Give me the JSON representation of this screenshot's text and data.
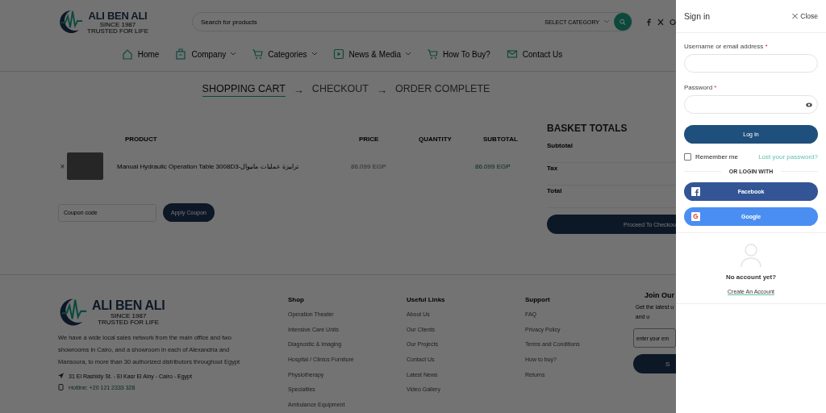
{
  "header": {
    "logo": {
      "name": "ALI BEN ALI",
      "since": "SINCE 1987",
      "tagline": "TRUSTED FOR LIFE"
    },
    "search": {
      "placeholder": "Search for products",
      "category": "SELECT CATEGORY"
    }
  },
  "nav": [
    {
      "label": "Home",
      "dropdown": false
    },
    {
      "label": "Company",
      "dropdown": true
    },
    {
      "label": "Categories",
      "dropdown": true
    },
    {
      "label": "News & Media",
      "dropdown": true
    },
    {
      "label": "How To Buy?",
      "dropdown": false
    },
    {
      "label": "Contact Us",
      "dropdown": false
    }
  ],
  "steps": [
    {
      "label": "SHOPPING CART",
      "selected": true
    },
    {
      "arrow": "→",
      "label": "CHECKOUT",
      "selected": false
    },
    {
      "arrow": "→",
      "label": "ORDER COMPLETE",
      "selected": false
    }
  ],
  "cart": {
    "columns": [
      "PRODUCT",
      "PRICE",
      "QUANTITY",
      "SUBTOTAL"
    ],
    "rows": [
      {
        "remove": "×",
        "product": "Manual Hydraulic Operation Table 3008D3-ترابيزة عمليات مانيوال",
        "price": "86.099 EGP",
        "subtotal": "86.099 EGP"
      }
    ],
    "coupon": {
      "placeholder": "Coupon code",
      "button": "Apply Coupon"
    }
  },
  "totals": {
    "title": "BASKET TOTALS",
    "rows": [
      "Subtotal",
      "Tax",
      "Total"
    ],
    "button": "Proceed To Checkou"
  },
  "footer": {
    "logo": {
      "name": "ALI BEN ALI",
      "since": "SINCE 1987",
      "tagline": "TRUSTED FOR LIFE"
    },
    "about": "We have a wide local sales network from the main office and two showrooms in Cairo, and a showroom in each of Alexandria and Mansoura, to more than 30 authorized distributors throughout Egypt",
    "address": "31 El Rashidy St. - El Kasr El Ainy - Cairo - Egypt",
    "hotline": "Hotline: +20 121 2333 328",
    "columns": [
      {
        "title": "Shop",
        "links": [
          "Operation Theater",
          "Intensive Care Units",
          "Diagnostic & Imaging",
          "Hospital / Clinics Furniture",
          "Physiotherapy",
          "Specialties",
          "Ambulance Equipment"
        ]
      },
      {
        "title": "Useful Links",
        "links": [
          "About Us",
          "Our Clients",
          "Our Projects",
          "Contact Us",
          "Latest News",
          "Video Gallery"
        ]
      },
      {
        "title": "Support",
        "links": [
          "FAQ",
          "Privacy Policy",
          "Terms and Conditions",
          "How to buy?",
          "Returns"
        ]
      }
    ],
    "newsletter": {
      "title": "Join Our",
      "text": [
        "Get the latest u",
        "and u"
      ],
      "placeholder": "enter your em",
      "button": "S"
    }
  },
  "signin": {
    "title": "Sign in",
    "close": "Close",
    "username_label": "Username or email address",
    "password_label": "Password",
    "required": "*",
    "login": "Log In",
    "remember": {
      "label": "Remember me",
      "checked": false
    },
    "lost": "Lost your password?",
    "divider": "OR LOGIN WITH",
    "facebook": "Facebook",
    "google": "Google",
    "no_account": "No account yet?",
    "create": "Create An Account"
  }
}
